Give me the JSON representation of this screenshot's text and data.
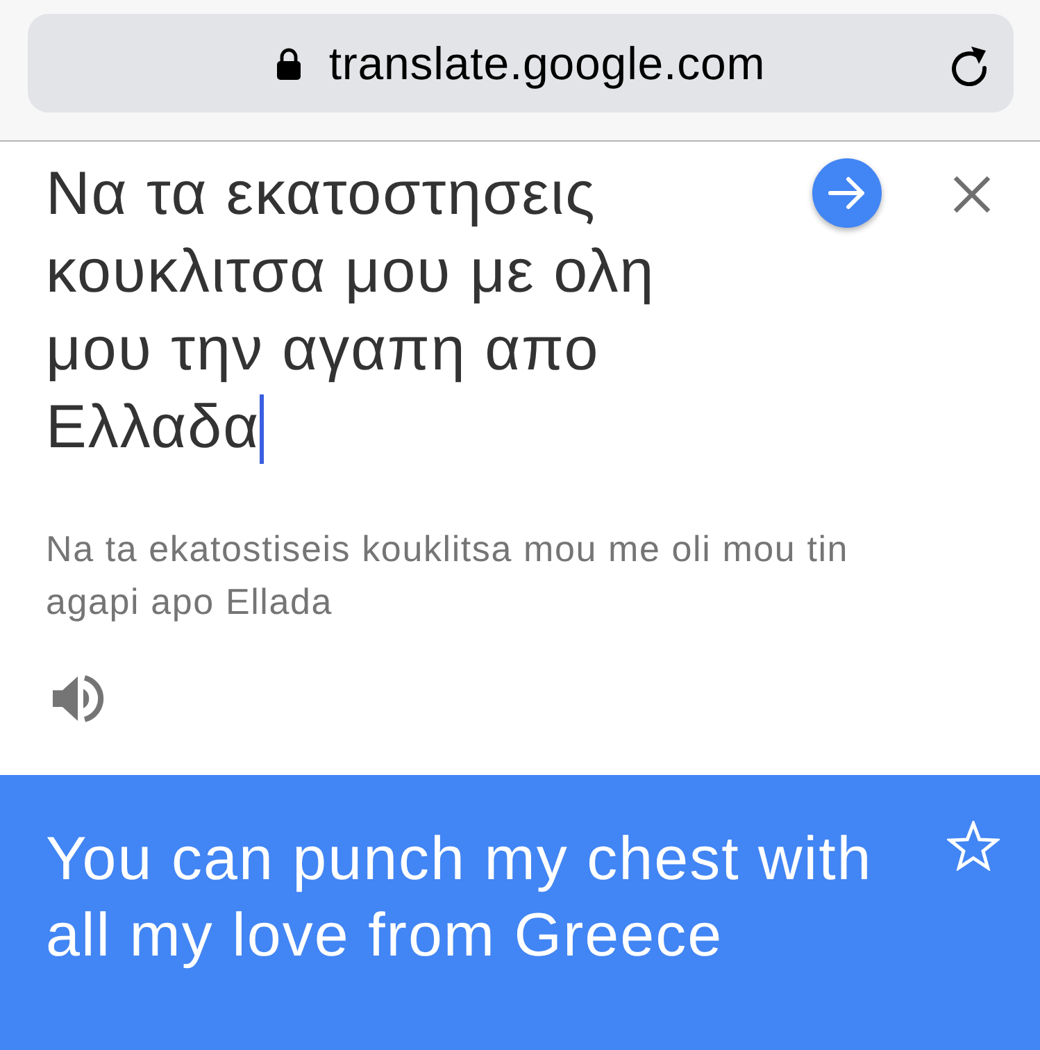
{
  "browser": {
    "url": "translate.google.com",
    "secure": true
  },
  "source": {
    "text": "Να τα εκατοστησεις κουκλιτσα μου με ολη μου την αγαπη απο Ελλαδα",
    "focused": true,
    "transliteration": "Na ta ekatostiseis kouklitsa mou me oli mou tin agapi apo Ellada"
  },
  "translation": {
    "text": "You can punch my chest with all my love from Greece",
    "starred": false
  }
}
